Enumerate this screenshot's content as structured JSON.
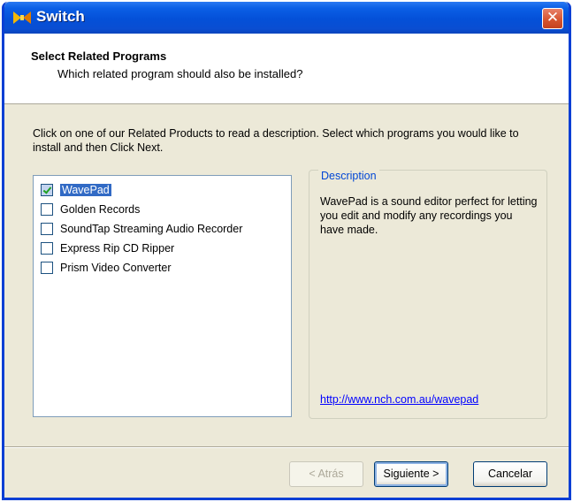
{
  "window": {
    "title": "Switch",
    "close_glyph": "✕",
    "accent_color": "#0a4ed2"
  },
  "header": {
    "title": "Select Related Programs",
    "subtitle": "Which related program should also be installed?"
  },
  "instruction": "Click on one of our Related Products to read a description. Select which programs you would like to install and then Click Next.",
  "programs": [
    {
      "label": "WavePad",
      "checked": true,
      "selected": true
    },
    {
      "label": "Golden Records",
      "checked": false,
      "selected": false
    },
    {
      "label": "SoundTap Streaming Audio Recorder",
      "checked": false,
      "selected": false
    },
    {
      "label": "Express Rip CD Ripper",
      "checked": false,
      "selected": false
    },
    {
      "label": "Prism Video Converter",
      "checked": false,
      "selected": false
    }
  ],
  "description": {
    "legend": "Description",
    "text": "WavePad is a sound editor perfect for letting you edit and modify any recordings you have made.",
    "link": "http://www.nch.com.au/wavepad"
  },
  "buttons": {
    "back": "< Atrás",
    "next": "Siguiente >",
    "cancel": "Cancelar"
  }
}
